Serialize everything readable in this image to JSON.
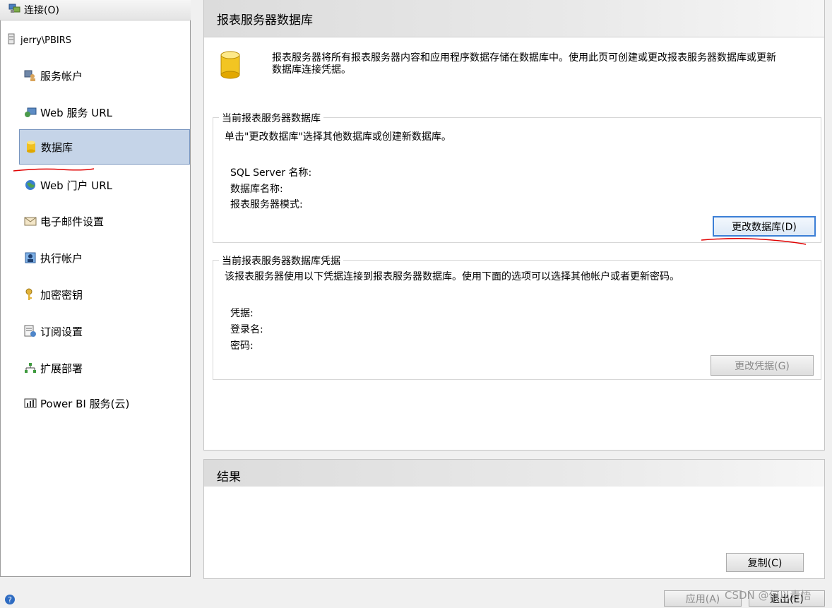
{
  "toolbar": {
    "connect_label": "连接(O)"
  },
  "sidebar": {
    "server_name": "jerry\\PBIRS",
    "items": [
      {
        "label": "服务帐户",
        "icon": "service-account-icon"
      },
      {
        "label": "Web 服务 URL",
        "icon": "web-service-icon"
      },
      {
        "label": "数据库",
        "icon": "database-icon",
        "active": true
      },
      {
        "label": "Web 门户 URL",
        "icon": "globe-icon"
      },
      {
        "label": "电子邮件设置",
        "icon": "email-icon"
      },
      {
        "label": "执行帐户",
        "icon": "execution-account-icon"
      },
      {
        "label": "加密密钥",
        "icon": "keys-icon"
      },
      {
        "label": "订阅设置",
        "icon": "subscription-icon"
      },
      {
        "label": "扩展部署",
        "icon": "scale-out-icon"
      },
      {
        "label": "Power BI 服务(云)",
        "icon": "powerbi-icon"
      }
    ]
  },
  "main": {
    "title": "报表服务器数据库",
    "intro": "报表服务器将所有报表服务器内容和应用程序数据存储在数据库中。使用此页可创建或更改报表服务器数据库或更新数据库连接凭据。",
    "db_group": {
      "legend": "当前报表服务器数据库",
      "description": "单击\"更改数据库\"选择其他数据库或创建新数据库。",
      "fields": [
        "SQL Server 名称:",
        "数据库名称:",
        "报表服务器模式:"
      ],
      "button": "更改数据库(D)"
    },
    "cred_group": {
      "legend": "当前报表服务器数据库凭据",
      "description": "该报表服务器使用以下凭据连接到报表服务器数据库。使用下面的选项可以选择其他帐户或者更新密码。",
      "fields": [
        "凭据:",
        "登录名:",
        "密码:"
      ],
      "button": "更改凭据(G)"
    }
  },
  "results": {
    "title": "结果",
    "copy_button": "复制(C)"
  },
  "footer": {
    "apply_button": "应用(A)",
    "exit_button": "退出(E)",
    "watermark": "CSDN @何以青悟"
  },
  "colors": {
    "active_bg": "#c5d4e8",
    "accent": "#3c7fd6",
    "annotation": "#e00000"
  }
}
